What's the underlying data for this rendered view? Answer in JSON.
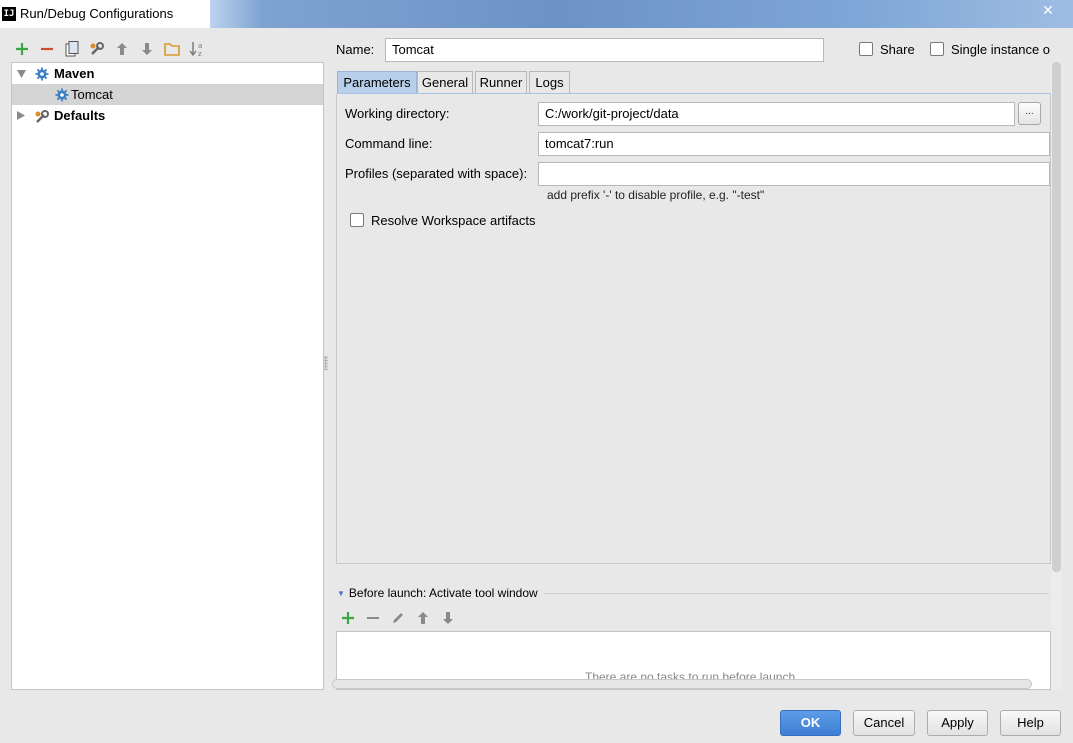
{
  "window": {
    "title": "Run/Debug Configurations",
    "app_icon_text": "IJ",
    "close_glyph": "✕"
  },
  "left_toolbar": {
    "icons": [
      "add-icon",
      "remove-icon",
      "copy-icon",
      "edit-defaults-icon",
      "move-up-icon",
      "move-down-icon",
      "folder-icon",
      "sort-icon"
    ]
  },
  "tree": {
    "items": [
      {
        "label": "Maven",
        "expanded": true,
        "bold": true
      },
      {
        "label": "Tomcat",
        "selected": true
      },
      {
        "label": "Defaults",
        "expanded": false,
        "bold": true
      }
    ]
  },
  "header": {
    "name_label": "Name:",
    "name_value": "Tomcat",
    "share_label": "Share",
    "single_instance_label": "Single instance o"
  },
  "tabs": [
    {
      "label": "Parameters",
      "active": true
    },
    {
      "label": "General",
      "active": false
    },
    {
      "label": "Runner",
      "active": false
    },
    {
      "label": "Logs",
      "active": false
    }
  ],
  "parameters": {
    "working_dir_label": "Working directory:",
    "working_dir_value": "C:/work/git-project/data",
    "browse_label": "...",
    "command_line_label": "Command line:",
    "command_line_value": "tomcat7:run",
    "profiles_label": "Profiles (separated with space):",
    "profiles_value": "",
    "profiles_hint": "add prefix '-' to disable profile, e.g. \"-test\"",
    "resolve_label": "Resolve Workspace artifacts"
  },
  "before_launch": {
    "header": "Before launch: Activate tool window",
    "empty_text": "There are no tasks to run before launch",
    "icons": [
      "add-icon",
      "remove-icon",
      "edit-icon",
      "move-up-icon",
      "move-down-icon"
    ]
  },
  "buttons": {
    "ok": "OK",
    "cancel": "Cancel",
    "apply": "Apply",
    "help": "Help"
  },
  "colors": {
    "accent_blue": "#3d7fd3",
    "add_green": "#3aa545",
    "remove_red": "#d04a2c",
    "folder_orange": "#d99a2a"
  }
}
